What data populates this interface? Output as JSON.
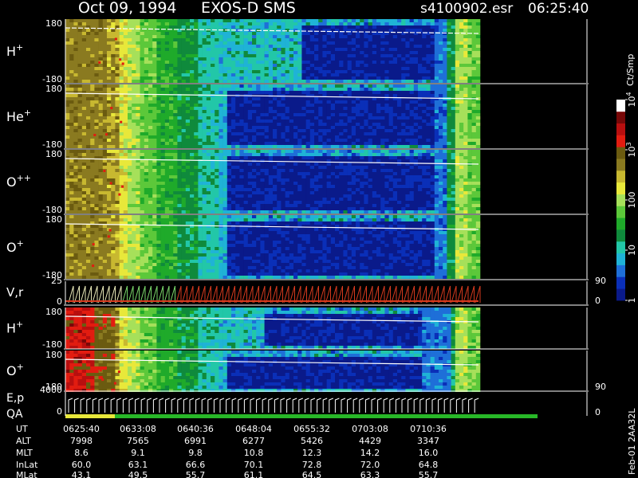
{
  "header": {
    "date": "Oct 09, 1994",
    "instrument": "EXOS-D SMS",
    "filename": "s4100902.esr",
    "time": "06:25:40"
  },
  "colors": {
    "background": "#000000",
    "foreground": "#ffffff",
    "scale": [
      "#0a1a8a",
      "#0a2fb8",
      "#1e6fd8",
      "#1fb3d6",
      "#22c7a8",
      "#0f8a3c",
      "#1faa2a",
      "#5cc83a",
      "#a6e05a",
      "#e8e83a",
      "#c8b830",
      "#8a7a20",
      "#6b5b10",
      "#e21c10",
      "#b80f0f",
      "#780808",
      "#ffffff"
    ],
    "vr_a": "#e8e8b8",
    "vr_b": "#7ad66a",
    "vr_c": "#d63a1e",
    "qa_a": "#e8e83a",
    "qa_b": "#28b828"
  },
  "chart_data": {
    "type": "heatmap",
    "x_unit": "UT",
    "x_range": [
      "06:25:40",
      "07:13:00"
    ],
    "panels": [
      {
        "name": "H+",
        "label_base": "H",
        "label_sup": "+",
        "ymin": "-180",
        "ymax": "180",
        "sweep": "ion",
        "ion_index": 0
      },
      {
        "name": "He+",
        "label_base": "He",
        "label_sup": "+",
        "ymin": "-180",
        "ymax": "180",
        "sweep": "ion",
        "ion_index": 1
      },
      {
        "name": "O++",
        "label_base": "O",
        "label_sup": "++",
        "ymin": "-180",
        "ymax": "180",
        "sweep": "ion",
        "ion_index": 2
      },
      {
        "name": "O+",
        "label_base": "O",
        "label_sup": "+",
        "ymin": "-180",
        "ymax": "180",
        "sweep": "ion",
        "ion_index": 3
      },
      {
        "name": "V,r",
        "label_base": "V,r",
        "label_sup": "",
        "ymin": "0",
        "ymax": "25",
        "right_min": "0",
        "right_max": "90",
        "sweep": "vr"
      },
      {
        "name": "H+",
        "label_base": "H",
        "label_sup": "+",
        "ymin": "-180",
        "ymax": "180",
        "sweep": "ion2",
        "ion_index": 0
      },
      {
        "name": "O+",
        "label_base": "O",
        "label_sup": "+",
        "ymin": "-180",
        "ymax": "180",
        "sweep": "ion2",
        "ion_index": 3
      },
      {
        "name": "E,p QA",
        "label_base": "E,p",
        "label_line2": "QA",
        "label_sup": "",
        "ymin": "0",
        "ymax": "4000",
        "right_min": "0",
        "right_max": "90",
        "sweep": "ep"
      }
    ],
    "colorbar": {
      "unit": "Ct/Smp",
      "labels": [
        {
          "text": "1",
          "sup": "",
          "value": 1
        },
        {
          "text": "10",
          "sup": "",
          "value": 10
        },
        {
          "text": "100",
          "sup": "",
          "value": 100
        },
        {
          "text": "10",
          "sup": "3",
          "value": 1000
        },
        {
          "text": "10",
          "sup": "4",
          "value": 10000
        }
      ]
    },
    "ephemeris": {
      "rows": [
        {
          "label": "UT",
          "values": [
            "0625:40",
            "0633:08",
            "0640:36",
            "0648:04",
            "0655:32",
            "0703:08",
            "0710:36"
          ]
        },
        {
          "label": "ALT",
          "values": [
            "7998",
            "7565",
            "6991",
            "6277",
            "5426",
            "4429",
            "3347"
          ]
        },
        {
          "label": "MLT",
          "values": [
            "8.6",
            "9.1",
            "9.8",
            "10.8",
            "12.3",
            "14.2",
            "16.0"
          ]
        },
        {
          "label": "InLat",
          "values": [
            "60.0",
            "63.1",
            "66.6",
            "70.1",
            "72.8",
            "72.0",
            "64.8"
          ]
        },
        {
          "label": "MLat",
          "values": [
            "43.1",
            "49.5",
            "55.7",
            "61.1",
            "64.5",
            "63.3",
            "55.7"
          ]
        }
      ]
    },
    "footer_version": "Feb-01 2AA32L"
  }
}
